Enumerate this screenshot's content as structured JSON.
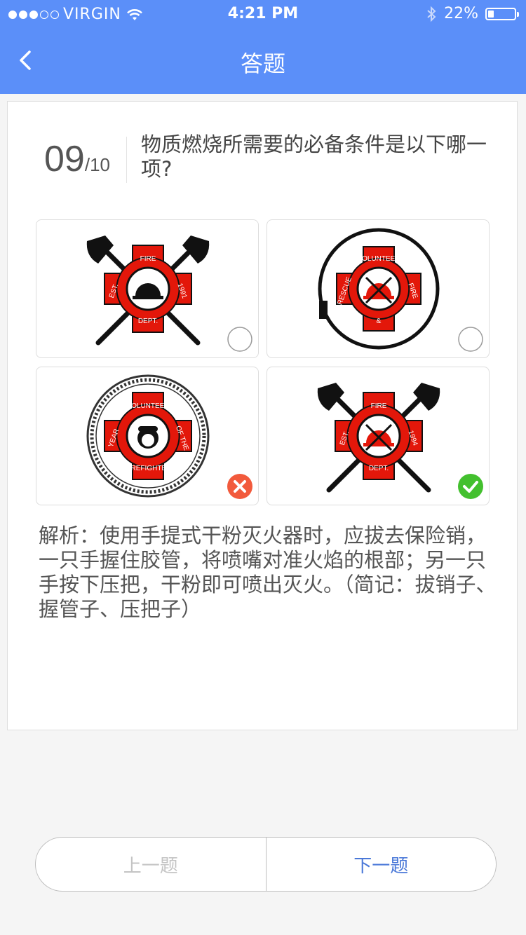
{
  "status_bar": {
    "carrier": "VIRGIN",
    "signal_dots": [
      true,
      true,
      true,
      false,
      false
    ],
    "time": "4:21 PM",
    "battery_percent_text": "22%",
    "battery_level": 0.22,
    "icons": [
      "wifi-icon",
      "bluetooth-icon",
      "battery-icon"
    ]
  },
  "nav": {
    "title": "答题",
    "back_icon": "chevron-left-icon"
  },
  "question": {
    "current": "09",
    "total": "/10",
    "text": "物质燃烧所需要的必备条件是以下哪一项?"
  },
  "options": [
    {
      "id": "a",
      "badge": {
        "top": "FIRE",
        "left": "EST.",
        "right": "1991",
        "bottom": "DEPT."
      },
      "state": "unselected"
    },
    {
      "id": "b",
      "badge": {
        "top": "VOLUNTEER",
        "left": "RESCUE",
        "right": "FIRE",
        "bottom": "&"
      },
      "state": "unselected"
    },
    {
      "id": "c",
      "badge": {
        "top": "VOLUNTEER",
        "left": "YEAR",
        "right": "OF THE",
        "bottom": "FIREFIGHTER"
      },
      "state": "wrong"
    },
    {
      "id": "d",
      "badge": {
        "top": "FIRE",
        "left": "EST.",
        "right": "1994",
        "bottom": "DEPT."
      },
      "state": "correct"
    }
  ],
  "analysis": {
    "text": "解析：使用手提式干粉灭火器时，应拔去保险销，一只手握住胶管，将喷嘴对准火焰的根部；另一只手按下压把，干粉即可喷出灭火。（简记：拔销子、握管子、压把子）"
  },
  "buttons": {
    "prev_label": "上一题",
    "next_label": "下一题"
  },
  "colors": {
    "header": "#5b8ff9",
    "badge_red": "#e3170a",
    "wrong": "#f25a3c",
    "correct": "#43c02e",
    "next_text": "#4a78d8"
  }
}
